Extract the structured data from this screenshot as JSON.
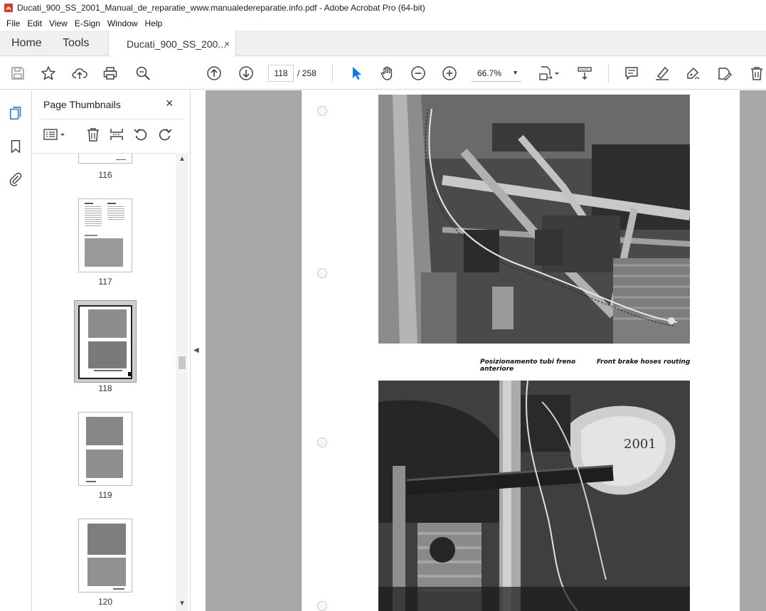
{
  "window": {
    "title": "Ducati_900_SS_2001_Manual_de_reparatie_www.manualedereparatie.info.pdf - Adobe Acrobat Pro (64-bit)"
  },
  "menu": [
    "File",
    "Edit",
    "View",
    "E-Sign",
    "Window",
    "Help"
  ],
  "tabs": {
    "home": "Home",
    "tools": "Tools",
    "document": "Ducati_900_SS_200...",
    "close": "×"
  },
  "toolbar": {
    "page_current": "118",
    "page_total": "/ 258",
    "zoom": "66.7%"
  },
  "thumbnails": {
    "title": "Page Thumbnails",
    "close": "×",
    "pages": [
      "116",
      "117",
      "118",
      "119",
      "120"
    ],
    "selected": "118"
  },
  "document": {
    "caption_it": "Posizionamento tubi freno anteriore",
    "caption_en": "Front brake hoses routing",
    "headlight_label": "2001"
  },
  "colors": {
    "accent": "#1473e6",
    "pdf_red": "#d83b2b",
    "doc_bg": "#a8a8a8"
  }
}
